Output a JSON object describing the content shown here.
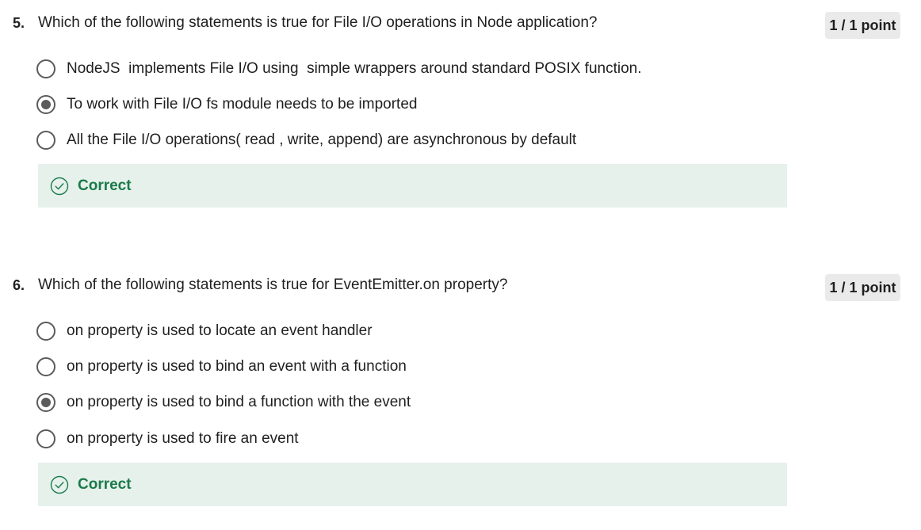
{
  "questions": [
    {
      "number": "5.",
      "text": "Which of the following statements is true for File I/O operations in Node application?",
      "points": "1 / 1 point",
      "options": [
        {
          "label": "NodeJS  implements File I/O using  simple wrappers around standard POSIX function.",
          "selected": false
        },
        {
          "label": "To work with File I/O fs module needs to be imported",
          "selected": true
        },
        {
          "label": "All the File I/O operations( read , write, append) are asynchronous by default",
          "selected": false
        }
      ],
      "feedback": "Correct"
    },
    {
      "number": "6.",
      "text": "Which of the following statements is true for EventEmitter.on property?",
      "points": "1 / 1 point",
      "options": [
        {
          "label": "on property is used to locate an event handler",
          "selected": false
        },
        {
          "label": "on property is used to bind an event with a function",
          "selected": false
        },
        {
          "label": "on property is used to bind a function with the event",
          "selected": true
        },
        {
          "label": "on property is used to fire an event",
          "selected": false
        }
      ],
      "feedback": "Correct"
    }
  ],
  "colors": {
    "correct_text": "#1b7a4a",
    "feedback_bg": "#e6f1ec",
    "badge_bg": "#eaeaea",
    "radio": "#5b5b5b"
  },
  "icons": {
    "feedback": "check-circle-icon"
  }
}
